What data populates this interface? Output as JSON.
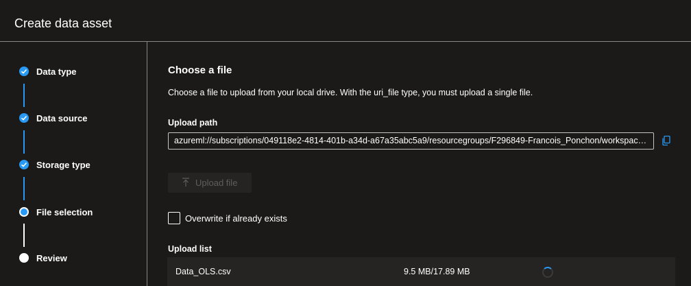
{
  "header": {
    "title": "Create data asset"
  },
  "steps": [
    {
      "label": "Data type",
      "state": "done"
    },
    {
      "label": "Data source",
      "state": "done"
    },
    {
      "label": "Storage type",
      "state": "done"
    },
    {
      "label": "File selection",
      "state": "current"
    },
    {
      "label": "Review",
      "state": "todo"
    }
  ],
  "main": {
    "heading": "Choose a file",
    "description": "Choose a file to upload from your local drive. With the uri_file type, you must upload a single file.",
    "upload_path_label": "Upload path",
    "upload_path_value": "azureml://subscriptions/049118e2-4814-401b-a34d-a67a35abc5a9/resourcegroups/F296849-Francois_Ponchon/workspaces/...",
    "upload_button_label": "Upload file",
    "overwrite_label": "Overwrite if already exists",
    "overwrite_checked": false,
    "upload_list_label": "Upload list",
    "upload_list": [
      {
        "name": "Data_OLS.csv",
        "progress": "9.5 MB/17.89 MB"
      }
    ]
  },
  "colors": {
    "accent": "#2899f5",
    "background": "#1b1a19",
    "divider": "#8a8886"
  },
  "icons": {
    "step_done": "checkmark-icon",
    "copy": "copy-icon",
    "upload": "upload-arrow-icon",
    "loading": "spinner-icon"
  }
}
